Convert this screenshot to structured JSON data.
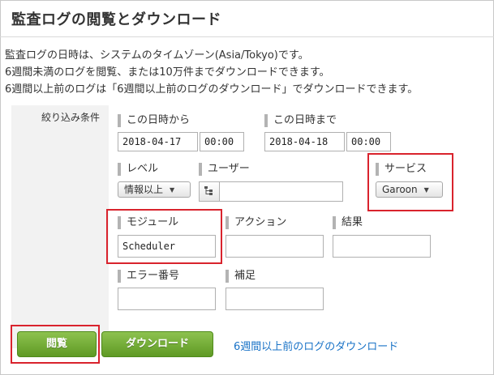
{
  "page": {
    "title": "監査ログの閲覧とダウンロード",
    "description": [
      "監査ログの日時は、システムのタイムゾーン(Asia/Tokyo)です。",
      "6週間未満のログを閲覧、または10万件までダウンロードできます。",
      "6週間以上前のログは「6週間以上前のログのダウンロード」でダウンロードできます。"
    ]
  },
  "filter": {
    "section_label": "絞り込み条件",
    "from": {
      "label": "この日時から",
      "date": "2018-04-17",
      "time": "00:00"
    },
    "to": {
      "label": "この日時まで",
      "date": "2018-04-18",
      "time": "00:00"
    },
    "level": {
      "label": "レベル",
      "selected": "情報以上"
    },
    "user": {
      "label": "ユーザー",
      "value": ""
    },
    "service": {
      "label": "サービス",
      "selected": "Garoon"
    },
    "module": {
      "label": "モジュール",
      "value": "Scheduler"
    },
    "action": {
      "label": "アクション",
      "value": ""
    },
    "result": {
      "label": "結果",
      "value": ""
    },
    "error_number": {
      "label": "エラー番号",
      "value": ""
    },
    "supplement": {
      "label": "補足",
      "value": ""
    }
  },
  "actions": {
    "view_label": "閲覧",
    "download_label": "ダウンロード",
    "old_logs_link": "6週間以上前のログのダウンロード"
  },
  "icons": {
    "user_picker": "org-tree-icon",
    "dropdown": "triangle-down-icon"
  },
  "colors": {
    "highlight": "#d9232d",
    "button_green": "#6aa82e",
    "link": "#1a73c7"
  }
}
